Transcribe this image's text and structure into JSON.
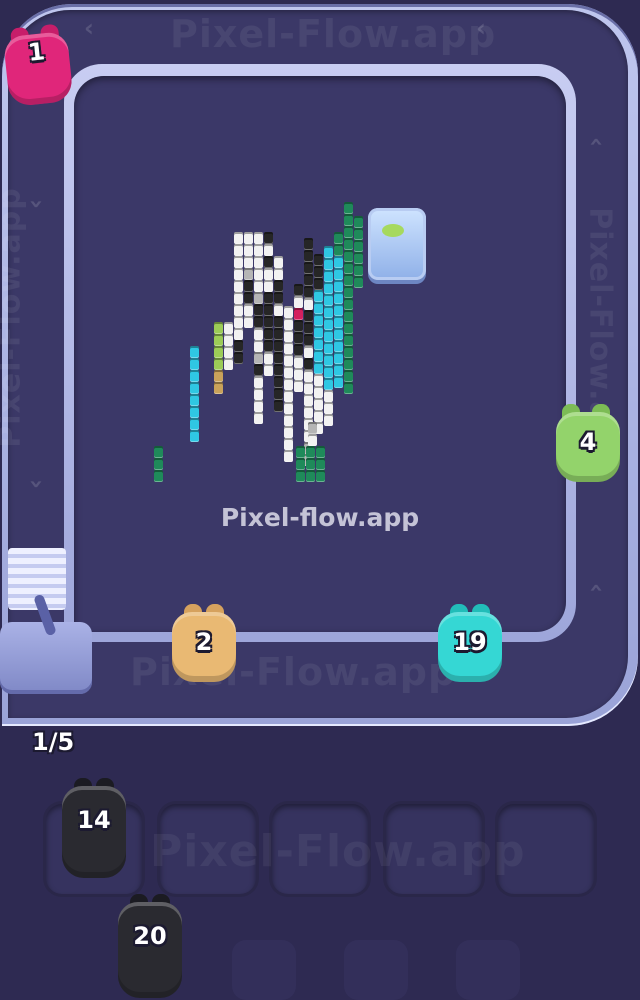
{
  "game": {
    "watermark": "Pixel-flow.app",
    "track_label_top": "Pixel-Flow.app",
    "track_label_bottom": "Pixel-Flow.app",
    "track_label_left": "Pixel-Flow.app",
    "track_label_right": "Pixel-Flow.app",
    "queue_counter": "1/5",
    "slots_label": "Pixel-Flow.app"
  },
  "shooters_on_track": [
    {
      "id": "pink",
      "count": "1",
      "color": "#e0267a"
    },
    {
      "id": "green",
      "count": "4",
      "color": "#93d36b"
    },
    {
      "id": "tan",
      "count": "2",
      "color": "#e9b973"
    },
    {
      "id": "cyan",
      "count": "19",
      "color": "#35d7d4"
    }
  ],
  "shooters_waiting": [
    {
      "id": "black-1",
      "count": "14",
      "color": "#2a2a30"
    },
    {
      "id": "black-2",
      "count": "20",
      "color": "#2a2a30"
    }
  ],
  "palette": {
    "white": "#f2f2f2",
    "gray": "#b5b5b5",
    "black": "#262626",
    "cyan": "#2fc7e3",
    "teal_green": "#1f8a5a",
    "lime": "#9ccc57",
    "gold": "#c9a25a",
    "magenta": "#d4205e",
    "track": "#9aa3d8",
    "board": "#3b3868"
  },
  "slots_empty_count": 4
}
